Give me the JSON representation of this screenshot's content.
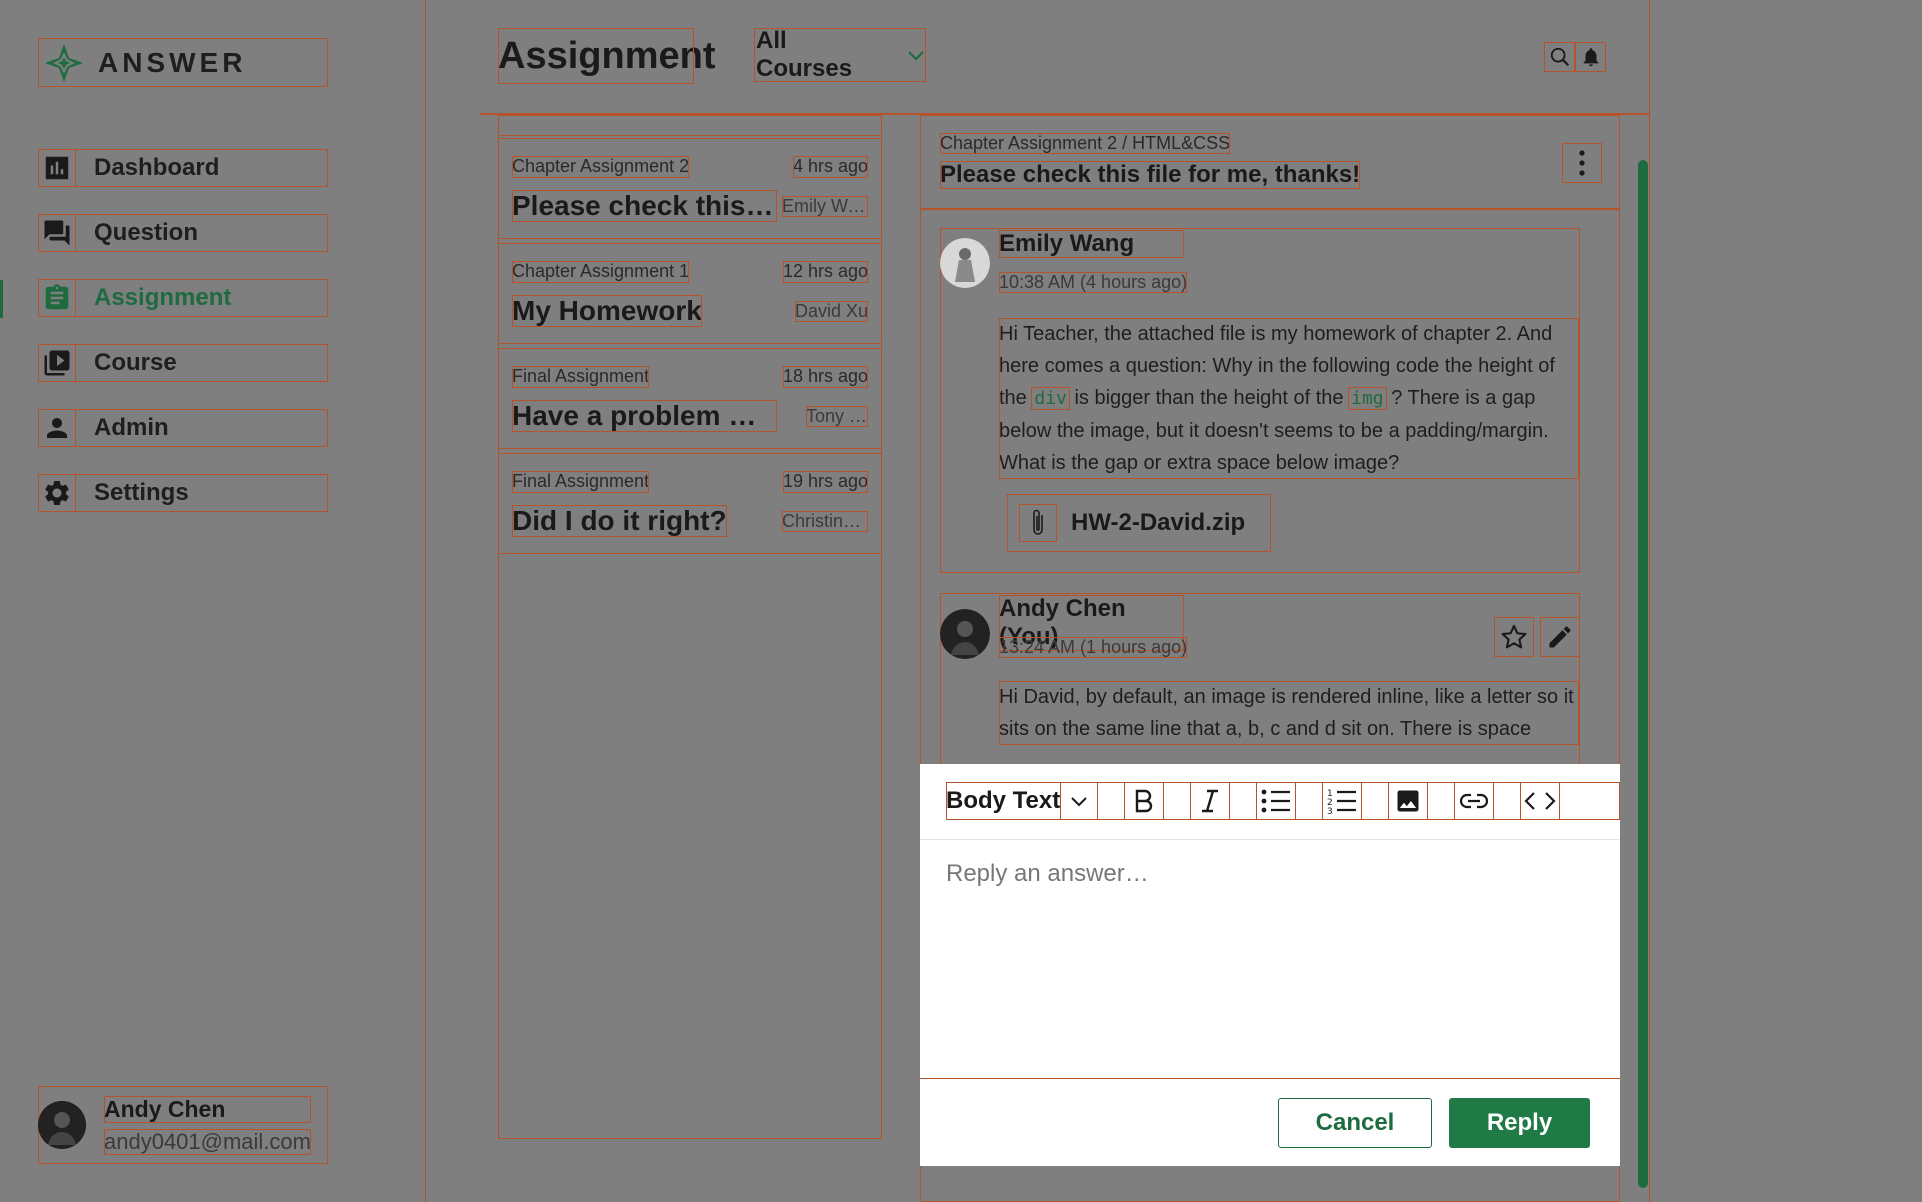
{
  "app": {
    "logo_text": "ANSWER"
  },
  "sidebar": {
    "items": [
      {
        "label": "Dashboard",
        "icon": "bar-chart-icon"
      },
      {
        "label": "Question",
        "icon": "chat-bubbles-icon"
      },
      {
        "label": "Assignment",
        "icon": "clipboard-icon",
        "active": true
      },
      {
        "label": "Course",
        "icon": "video-library-icon"
      },
      {
        "label": "Admin",
        "icon": "person-icon"
      },
      {
        "label": "Settings",
        "icon": "gear-icon"
      }
    ],
    "user": {
      "name": "Andy Chen",
      "email": "andy0401@mail.com"
    }
  },
  "header": {
    "title": "Assignment",
    "course_filter": "All Courses"
  },
  "assignments": [
    {
      "chapter": "Chapter Assignment 2",
      "time": "4 hrs ago",
      "title": "Please check this file for me, thanks!",
      "author": "Emily Wang"
    },
    {
      "chapter": "Chapter Assignment 1",
      "time": "12 hrs ago",
      "title": "My Homework",
      "author": "David Xu"
    },
    {
      "chapter": "Final Assignment",
      "time": "18 hrs ago",
      "title": "Have a problem with the final assignment",
      "author": "Tony Lee"
    },
    {
      "chapter": "Final Assignment",
      "time": "19 hrs ago",
      "title": "Did I do it right?",
      "author": "Christina Lin"
    }
  ],
  "thread": {
    "breadcrumb": "Chapter Assignment 2 / HTML&CSS",
    "title": "Please check this file for me, thanks!",
    "posts": [
      {
        "author": "Emily Wang",
        "time": "10:38 AM (4 hours ago)",
        "text_1": "Hi Teacher, the attached file is my homework of chapter 2. And here comes a question: Why in the following code the height of the",
        "code_1": "div",
        "text_2": "is bigger than the height of the",
        "code_2": "img",
        "text_3": "? There is a gap below the image, but it doesn't seems to be a padding/margin. What is the gap or extra space below image?",
        "attachment": "HW-2-David.zip"
      },
      {
        "author": "Andy Chen (You)",
        "time": "13:24 AM (1 hours ago)",
        "text": "Hi David, by default, an image is rendered inline, like a letter so it sits on the same line that a, b, c and d sit on. There is space"
      }
    ]
  },
  "editor": {
    "format": "Body Text",
    "placeholder": "Reply an answer…",
    "cancel_label": "Cancel",
    "reply_label": "Reply"
  },
  "colors": {
    "brand": "#1f6b40",
    "overlay": "#7f7f7f",
    "outline": "#b5532a"
  }
}
